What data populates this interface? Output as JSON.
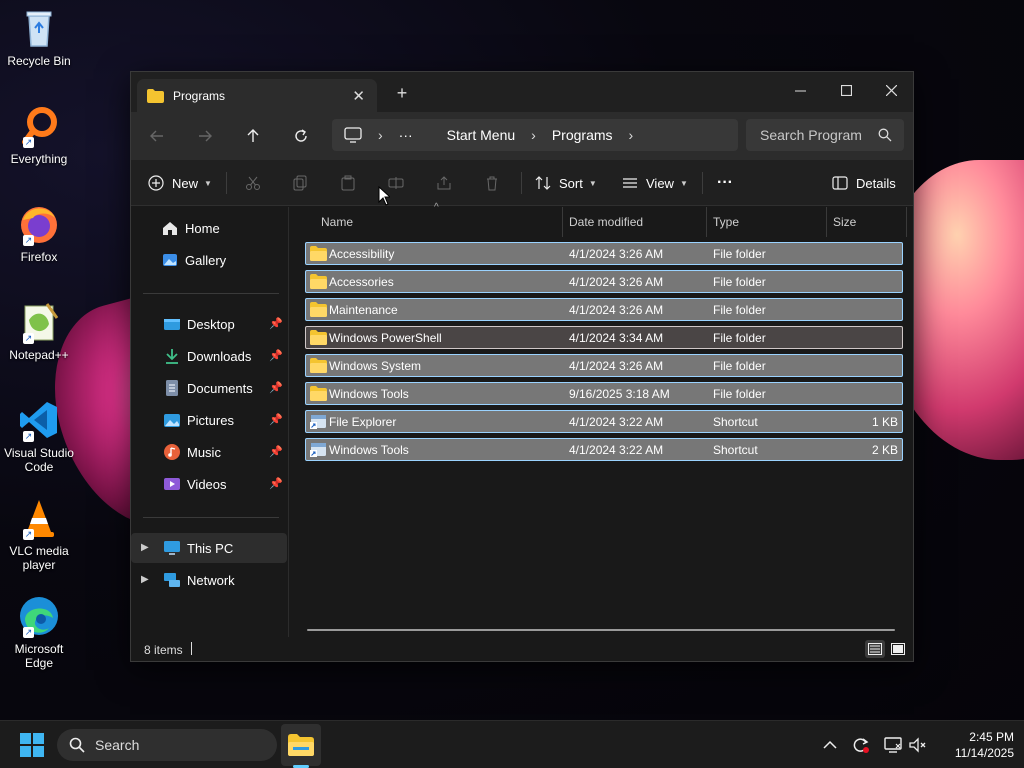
{
  "desktop": {
    "icons": [
      {
        "label": "Recycle Bin",
        "icon": "recycle-bin-icon"
      },
      {
        "label": "Everything",
        "icon": "everything-search-icon"
      },
      {
        "label": "Firefox",
        "icon": "firefox-icon"
      },
      {
        "label": "Notepad++",
        "icon": "notepad-plus-plus-icon"
      },
      {
        "label": "Visual Studio Code",
        "icon": "vscode-icon"
      },
      {
        "label": "VLC media player",
        "icon": "vlc-icon"
      },
      {
        "label": "Microsoft Edge",
        "icon": "edge-icon"
      }
    ]
  },
  "window": {
    "tab_title": "Programs",
    "new_tab": "+",
    "address": {
      "root_icon": "computer-icon",
      "ellipsis": "···",
      "crumbs": [
        "Start Menu",
        "Programs"
      ]
    },
    "search_placeholder": "Search Program",
    "commands": {
      "new_label": "New",
      "sort_label": "Sort",
      "view_label": "View",
      "more_label": "···",
      "details_label": "Details"
    },
    "sidebar": {
      "top": [
        {
          "label": "Home",
          "icon": "home-icon"
        },
        {
          "label": "Gallery",
          "icon": "gallery-icon"
        }
      ],
      "quick_access": [
        {
          "label": "Desktop",
          "icon": "desktop-folder-icon"
        },
        {
          "label": "Downloads",
          "icon": "downloads-icon"
        },
        {
          "label": "Documents",
          "icon": "documents-icon"
        },
        {
          "label": "Pictures",
          "icon": "pictures-icon"
        },
        {
          "label": "Music",
          "icon": "music-icon"
        },
        {
          "label": "Videos",
          "icon": "videos-icon"
        }
      ],
      "bottom": [
        {
          "label": "This PC",
          "icon": "this-pc-icon"
        },
        {
          "label": "Network",
          "icon": "network-icon"
        }
      ]
    },
    "columns": {
      "name": "Name",
      "date": "Date modified",
      "type": "Type",
      "size": "Size"
    },
    "files": [
      {
        "name": "Accessibility",
        "date": "4/1/2024 3:26 AM",
        "type": "File folder",
        "size": "",
        "icon": "folder-icon"
      },
      {
        "name": "Accessories",
        "date": "4/1/2024 3:26 AM",
        "type": "File folder",
        "size": "",
        "icon": "folder-icon"
      },
      {
        "name": "Maintenance",
        "date": "4/1/2024 3:26 AM",
        "type": "File folder",
        "size": "",
        "icon": "folder-icon"
      },
      {
        "name": "Windows PowerShell",
        "date": "4/1/2024 3:34 AM",
        "type": "File folder",
        "size": "",
        "icon": "folder-icon"
      },
      {
        "name": "Windows System",
        "date": "4/1/2024 3:26 AM",
        "type": "File folder",
        "size": "",
        "icon": "folder-icon"
      },
      {
        "name": "Windows Tools",
        "date": "9/16/2025 3:18 AM",
        "type": "File folder",
        "size": "",
        "icon": "folder-icon"
      },
      {
        "name": "File Explorer",
        "date": "4/1/2024 3:22 AM",
        "type": "Shortcut",
        "size": "1 KB",
        "icon": "shortcut-icon"
      },
      {
        "name": "Windows Tools",
        "date": "4/1/2024 3:22 AM",
        "type": "Shortcut",
        "size": "2 KB",
        "icon": "shortcut-icon"
      }
    ],
    "status": "8 items"
  },
  "taskbar": {
    "search_label": "Search",
    "time": "2:45 PM",
    "date": "11/14/2025"
  },
  "colors": {
    "accent": "#60cdff",
    "folder": "#f4c430",
    "selection_border": "#9bd3ff"
  }
}
